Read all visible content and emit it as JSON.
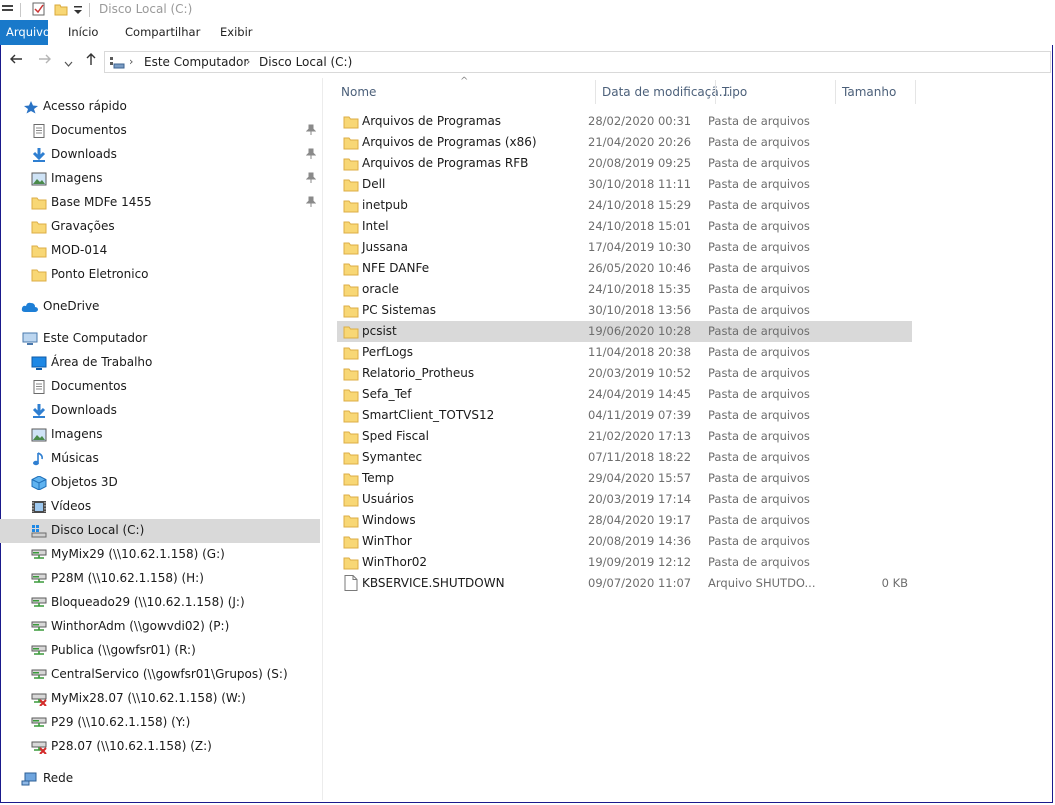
{
  "window": {
    "title": "Disco Local (C:)"
  },
  "ribbon": {
    "tabs": [
      "Arquivo",
      "Início",
      "Compartilhar",
      "Exibir"
    ]
  },
  "address": {
    "crumbs": [
      "Este Computador",
      "Disco Local (C:)"
    ]
  },
  "sidebar": {
    "quick_access": {
      "label": "Acesso rápido",
      "items": [
        {
          "label": "Documentos",
          "icon": "documents-icon",
          "pinned": true
        },
        {
          "label": "Downloads",
          "icon": "download-icon",
          "pinned": true
        },
        {
          "label": "Imagens",
          "icon": "pictures-icon",
          "pinned": true
        },
        {
          "label": "Base MDFe 1455",
          "icon": "folder-icon",
          "pinned": true
        },
        {
          "label": "Gravações",
          "icon": "folder-icon",
          "pinned": false
        },
        {
          "label": "MOD-014",
          "icon": "folder-icon",
          "pinned": false
        },
        {
          "label": "Ponto Eletronico",
          "icon": "folder-icon",
          "pinned": false
        }
      ]
    },
    "onedrive": {
      "label": "OneDrive"
    },
    "this_pc": {
      "label": "Este Computador",
      "items": [
        {
          "label": "Área de Trabalho",
          "icon": "desktop-icon"
        },
        {
          "label": "Documentos",
          "icon": "documents-icon"
        },
        {
          "label": "Downloads",
          "icon": "download-icon"
        },
        {
          "label": "Imagens",
          "icon": "pictures-icon"
        },
        {
          "label": "Músicas",
          "icon": "music-icon"
        },
        {
          "label": "Objetos 3D",
          "icon": "3d-objects-icon"
        },
        {
          "label": "Vídeos",
          "icon": "videos-icon"
        },
        {
          "label": "Disco Local (C:)",
          "icon": "local-disk-icon",
          "selected": true
        },
        {
          "label": "MyMix29 (\\\\10.62.1.158) (G:)",
          "icon": "network-drive-icon"
        },
        {
          "label": "P28M (\\\\10.62.1.158) (H:)",
          "icon": "network-drive-icon"
        },
        {
          "label": "Bloqueado29 (\\\\10.62.1.158) (J:)",
          "icon": "network-drive-icon"
        },
        {
          "label": "WinthorAdm (\\\\gowvdi02) (P:)",
          "icon": "network-drive-icon"
        },
        {
          "label": "Publica (\\\\gowfsr01) (R:)",
          "icon": "network-drive-icon"
        },
        {
          "label": "CentralServico (\\\\gowfsr01\\Grupos) (S:)",
          "icon": "network-drive-icon"
        },
        {
          "label": "MyMix28.07 (\\\\10.62.1.158) (W:)",
          "icon": "disconnected-drive-icon"
        },
        {
          "label": "P29 (\\\\10.62.1.158) (Y:)",
          "icon": "network-drive-icon"
        },
        {
          "label": "P28.07 (\\\\10.62.1.158) (Z:)",
          "icon": "disconnected-drive-icon"
        }
      ]
    },
    "network": {
      "label": "Rede"
    }
  },
  "columns": {
    "name": "Nome",
    "date": "Data de modificaçã...",
    "type": "Tipo",
    "size": "Tamanho"
  },
  "files": [
    {
      "name": "Arquivos de Programas",
      "date": "28/02/2020 00:31",
      "type": "Pasta de arquivos",
      "size": "",
      "kind": "folder"
    },
    {
      "name": "Arquivos de Programas (x86)",
      "date": "21/04/2020 20:26",
      "type": "Pasta de arquivos",
      "size": "",
      "kind": "folder"
    },
    {
      "name": "Arquivos de Programas RFB",
      "date": "20/08/2019 09:25",
      "type": "Pasta de arquivos",
      "size": "",
      "kind": "folder"
    },
    {
      "name": "Dell",
      "date": "30/10/2018 11:11",
      "type": "Pasta de arquivos",
      "size": "",
      "kind": "folder"
    },
    {
      "name": "inetpub",
      "date": "24/10/2018 15:29",
      "type": "Pasta de arquivos",
      "size": "",
      "kind": "folder"
    },
    {
      "name": "Intel",
      "date": "24/10/2018 15:01",
      "type": "Pasta de arquivos",
      "size": "",
      "kind": "folder"
    },
    {
      "name": "Jussana",
      "date": "17/04/2019 10:30",
      "type": "Pasta de arquivos",
      "size": "",
      "kind": "folder"
    },
    {
      "name": "NFE DANFe",
      "date": "26/05/2020 10:46",
      "type": "Pasta de arquivos",
      "size": "",
      "kind": "folder"
    },
    {
      "name": "oracle",
      "date": "24/10/2018 15:35",
      "type": "Pasta de arquivos",
      "size": "",
      "kind": "folder"
    },
    {
      "name": "PC Sistemas",
      "date": "30/10/2018 13:56",
      "type": "Pasta de arquivos",
      "size": "",
      "kind": "folder"
    },
    {
      "name": "pcsist",
      "date": "19/06/2020 10:28",
      "type": "Pasta de arquivos",
      "size": "",
      "kind": "folder",
      "hover": true
    },
    {
      "name": "PerfLogs",
      "date": "11/04/2018 20:38",
      "type": "Pasta de arquivos",
      "size": "",
      "kind": "folder"
    },
    {
      "name": "Relatorio_Protheus",
      "date": "20/03/2019 10:52",
      "type": "Pasta de arquivos",
      "size": "",
      "kind": "folder"
    },
    {
      "name": "Sefa_Tef",
      "date": "24/04/2019 14:45",
      "type": "Pasta de arquivos",
      "size": "",
      "kind": "folder"
    },
    {
      "name": "SmartClient_TOTVS12",
      "date": "04/11/2019 07:39",
      "type": "Pasta de arquivos",
      "size": "",
      "kind": "folder"
    },
    {
      "name": "Sped Fiscal",
      "date": "21/02/2020 17:13",
      "type": "Pasta de arquivos",
      "size": "",
      "kind": "folder"
    },
    {
      "name": "Symantec",
      "date": "07/11/2018 18:22",
      "type": "Pasta de arquivos",
      "size": "",
      "kind": "folder"
    },
    {
      "name": "Temp",
      "date": "29/04/2020 15:57",
      "type": "Pasta de arquivos",
      "size": "",
      "kind": "folder"
    },
    {
      "name": "Usuários",
      "date": "20/03/2019 17:14",
      "type": "Pasta de arquivos",
      "size": "",
      "kind": "folder"
    },
    {
      "name": "Windows",
      "date": "28/04/2020 19:17",
      "type": "Pasta de arquivos",
      "size": "",
      "kind": "folder"
    },
    {
      "name": "WinThor",
      "date": "20/08/2019 14:36",
      "type": "Pasta de arquivos",
      "size": "",
      "kind": "folder"
    },
    {
      "name": "WinThor02",
      "date": "19/09/2019 12:12",
      "type": "Pasta de arquivos",
      "size": "",
      "kind": "folder"
    },
    {
      "name": "KBSERVICE.SHUTDOWN",
      "date": "09/07/2020 11:07",
      "type": "Arquivo SHUTDO...",
      "size": "0 KB",
      "kind": "file"
    }
  ],
  "colors": {
    "accent": "#1979ca",
    "folder": "#f8d775",
    "folder_dark": "#e8b84a",
    "selection": "#d9d9d9"
  }
}
